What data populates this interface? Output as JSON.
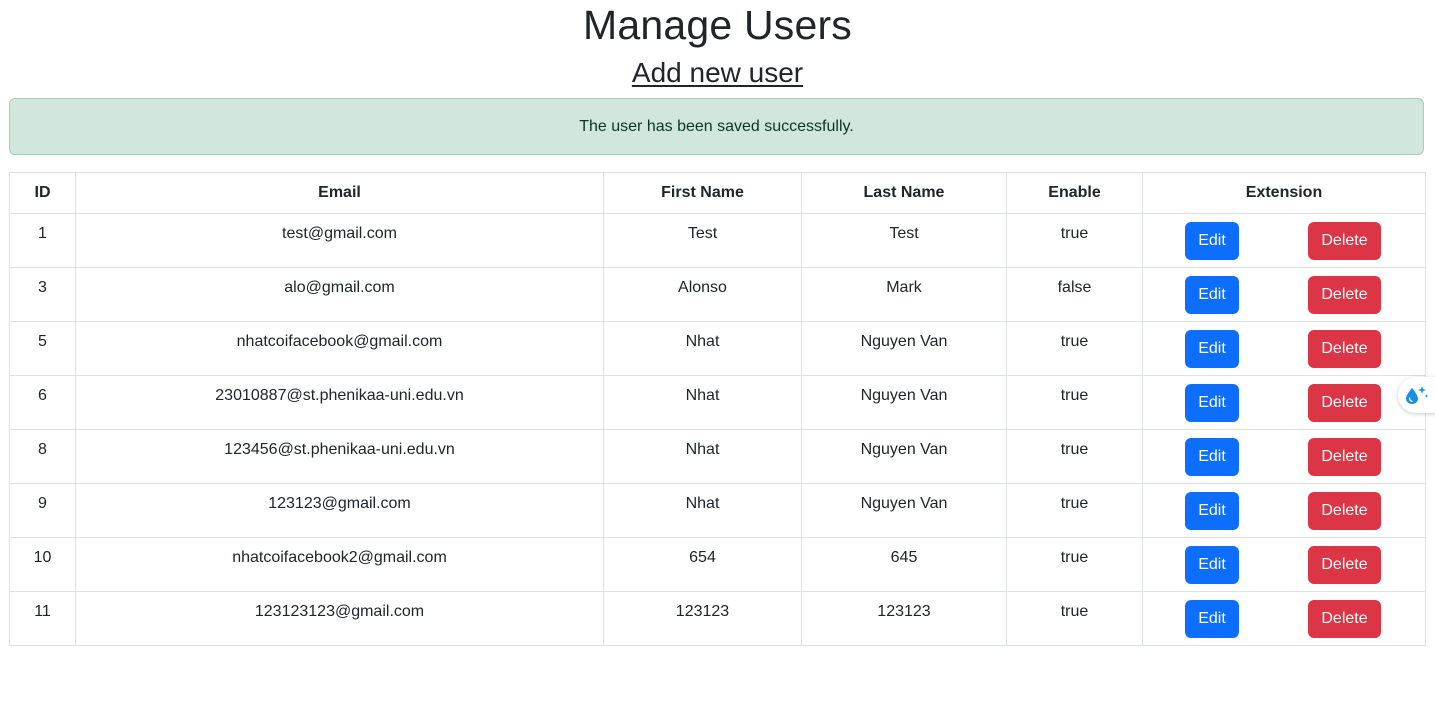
{
  "page": {
    "title": "Manage Users",
    "add_link": "Add new user",
    "alert": "The user has been saved successfully."
  },
  "table": {
    "headers": [
      "ID",
      "Email",
      "First Name",
      "Last Name",
      "Enable",
      "Extension"
    ],
    "rows": [
      {
        "id": "1",
        "email": "test@gmail.com",
        "first_name": "Test",
        "last_name": "Test",
        "enable": "true"
      },
      {
        "id": "3",
        "email": "alo@gmail.com",
        "first_name": "Alonso",
        "last_name": "Mark",
        "enable": "false"
      },
      {
        "id": "5",
        "email": "nhatcoifacebook@gmail.com",
        "first_name": "Nhat",
        "last_name": "Nguyen Van",
        "enable": "true"
      },
      {
        "id": "6",
        "email": "23010887@st.phenikaa-uni.edu.vn",
        "first_name": "Nhat",
        "last_name": "Nguyen Van",
        "enable": "true"
      },
      {
        "id": "8",
        "email": "123456@st.phenikaa-uni.edu.vn",
        "first_name": "Nhat",
        "last_name": "Nguyen Van",
        "enable": "true"
      },
      {
        "id": "9",
        "email": "123123@gmail.com",
        "first_name": "Nhat",
        "last_name": "Nguyen Van",
        "enable": "true"
      },
      {
        "id": "10",
        "email": "nhatcoifacebook2@gmail.com",
        "first_name": "654",
        "last_name": "645",
        "enable": "true"
      },
      {
        "id": "11",
        "email": "123123123@gmail.com",
        "first_name": "123123",
        "last_name": "123123",
        "enable": "true"
      }
    ],
    "edit_label": "Edit",
    "delete_label": "Delete"
  },
  "side_widget": {
    "icon": "water-drop-sparkle-icon"
  },
  "colors": {
    "edit_button": "#0d6efd",
    "delete_button": "#dc3545",
    "alert_background": "#d1e7dd",
    "alert_text": "#0a3622"
  }
}
